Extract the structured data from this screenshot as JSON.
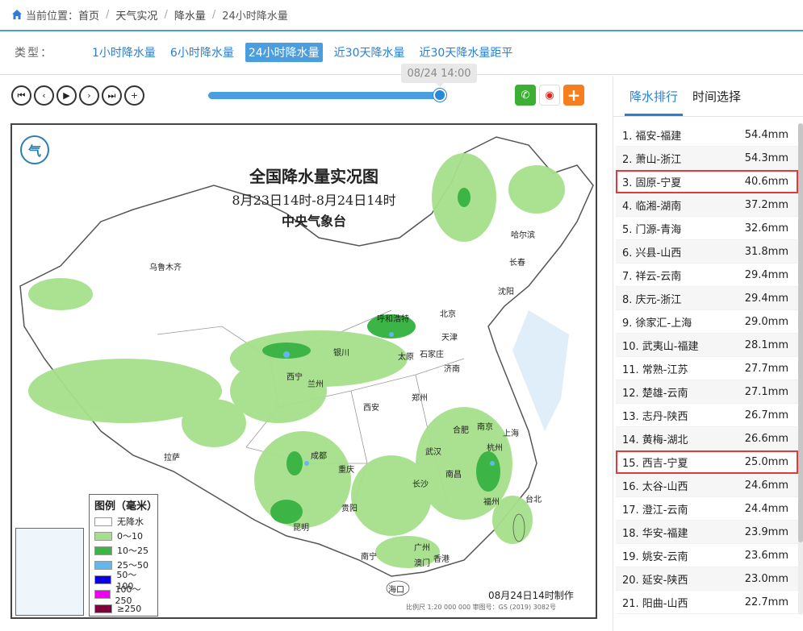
{
  "breadcrumb": {
    "prefix": "当前位置：",
    "items": [
      "首页",
      "天气实况",
      "降水量",
      "24小时降水量"
    ]
  },
  "typebar": {
    "label": "类型：",
    "options": [
      "1小时降水量",
      "6小时降水量",
      "24小时降水量",
      "近30天降水量",
      "近30天降水量距平"
    ],
    "active_index": 2
  },
  "player": {
    "current_time": "08/24 14:00",
    "progress": 1.0
  },
  "map": {
    "title": "全国降水量实况图",
    "subtitle": "8月23日14时-8月24日14时",
    "agency": "中央气象台",
    "made": "08月24日14时制作",
    "scale": "比例尺 1:20 000 000   审图号：GS (2019) 3082号",
    "cities": [
      "乌鲁木齐",
      "哈尔滨",
      "长春",
      "沈阳",
      "呼和浩特",
      "北京",
      "天津",
      "银川",
      "太原",
      "石家庄",
      "西宁",
      "兰州",
      "济南",
      "郑州",
      "西安",
      "拉萨",
      "成都",
      "重庆",
      "武汉",
      "合肥",
      "南京",
      "上海",
      "杭州",
      "长沙",
      "南昌",
      "福州",
      "台北",
      "贵阳",
      "昆明",
      "南宁",
      "广州",
      "香港",
      "澳门",
      "海口"
    ],
    "legend": {
      "title": "图例（毫米）",
      "items": [
        {
          "label": "无降水",
          "color": "#ffffff"
        },
        {
          "label": "0～10",
          "color": "#a6e08c"
        },
        {
          "label": "10～25",
          "color": "#3cb446"
        },
        {
          "label": "25～50",
          "color": "#62b8ee"
        },
        {
          "label": "50～100",
          "color": "#0a00e6"
        },
        {
          "label": "100～250",
          "color": "#f000f0"
        },
        {
          "label": "≥250",
          "color": "#800040"
        }
      ]
    }
  },
  "panel": {
    "tabs": [
      "降水排行",
      "时间选择"
    ],
    "ranking": [
      {
        "name": "1. 福安-福建",
        "value": "54.4mm"
      },
      {
        "name": "2. 萧山-浙江",
        "value": "54.3mm"
      },
      {
        "name": "3. 固原-宁夏",
        "value": "40.6mm"
      },
      {
        "name": "4. 临湘-湖南",
        "value": "37.2mm"
      },
      {
        "name": "5. 门源-青海",
        "value": "32.6mm"
      },
      {
        "name": "6. 兴县-山西",
        "value": "31.8mm"
      },
      {
        "name": "7. 祥云-云南",
        "value": "29.4mm"
      },
      {
        "name": "8. 庆元-浙江",
        "value": "29.4mm"
      },
      {
        "name": "9. 徐家汇-上海",
        "value": "29.0mm"
      },
      {
        "name": "10. 武夷山-福建",
        "value": "28.1mm"
      },
      {
        "name": "11. 常熟-江苏",
        "value": "27.7mm"
      },
      {
        "name": "12. 楚雄-云南",
        "value": "27.1mm"
      },
      {
        "name": "13. 志丹-陕西",
        "value": "26.7mm"
      },
      {
        "name": "14. 黄梅-湖北",
        "value": "26.6mm"
      },
      {
        "name": "15. 西吉-宁夏",
        "value": "25.0mm"
      },
      {
        "name": "16. 太谷-山西",
        "value": "24.6mm"
      },
      {
        "name": "17. 澄江-云南",
        "value": "24.4mm"
      },
      {
        "name": "18. 华安-福建",
        "value": "23.9mm"
      },
      {
        "name": "19. 姚安-云南",
        "value": "23.6mm"
      },
      {
        "name": "20. 延安-陕西",
        "value": "23.0mm"
      },
      {
        "name": "21. 阳曲-山西",
        "value": "22.7mm"
      }
    ],
    "highlighted_indices": [
      2,
      14
    ]
  }
}
